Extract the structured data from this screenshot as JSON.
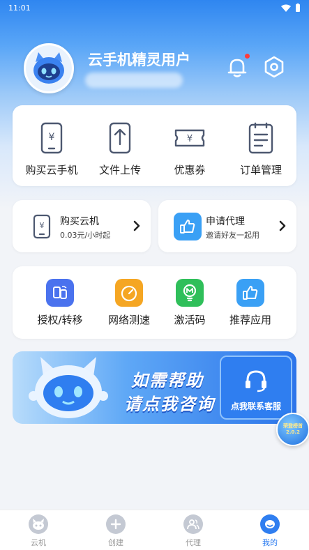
{
  "status_bar": {
    "time": "11:01"
  },
  "profile": {
    "username": "云手机精灵用户"
  },
  "quick_actions": [
    {
      "label": "购买云手机",
      "icon": "phone-yuan-icon"
    },
    {
      "label": "文件上传",
      "icon": "upload-icon"
    },
    {
      "label": "优惠券",
      "icon": "coupon-icon"
    },
    {
      "label": "订单管理",
      "icon": "order-list-icon"
    }
  ],
  "promos": [
    {
      "title": "购买云机",
      "subtitle": "0.03元/小时起",
      "icon": "phone-yuan-icon"
    },
    {
      "title": "申请代理",
      "subtitle": "邀请好友一起用",
      "icon": "thumbs-up-icon"
    }
  ],
  "tools": [
    {
      "label": "授权/转移",
      "icon": "authorize-transfer-icon",
      "color": "#4a72ee"
    },
    {
      "label": "网络测速",
      "icon": "speedometer-icon",
      "color": "#f5a623"
    },
    {
      "label": "激活码",
      "icon": "activation-bulb-icon",
      "color": "#2fbf5a"
    },
    {
      "label": "推荐应用",
      "icon": "thumbs-up-icon",
      "color": "#3aa0f5"
    }
  ],
  "banner": {
    "line1": "如需帮助",
    "line2": "请点我咨询",
    "button_label": "点我联系客服"
  },
  "float_badge": {
    "line1": "荣登榜首",
    "line2": "2.0.2"
  },
  "bottom_nav": [
    {
      "label": "云机",
      "icon": "robot-icon",
      "active": false
    },
    {
      "label": "创建",
      "icon": "plus-icon",
      "active": false
    },
    {
      "label": "代理",
      "icon": "agent-icon",
      "active": false
    },
    {
      "label": "我的",
      "icon": "my-icon",
      "active": true
    }
  ],
  "colors": {
    "accent": "#2f7ef0",
    "notification_dot": "#ff3b3b"
  }
}
